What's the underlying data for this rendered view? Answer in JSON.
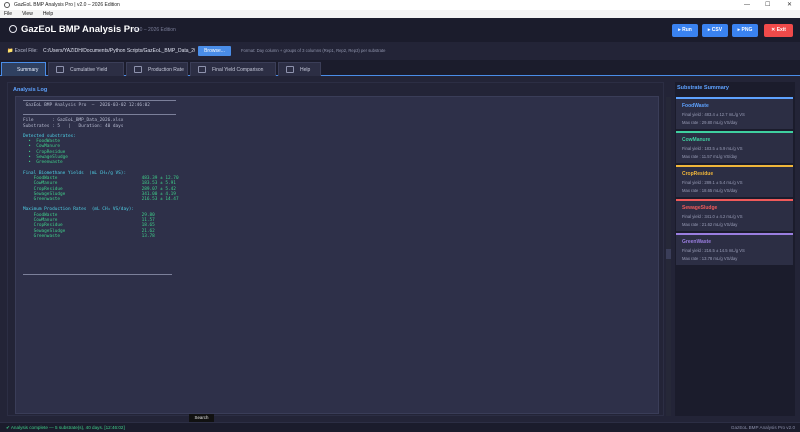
{
  "window": {
    "title": "GazEoL BMP Analysis Pro  |  v2.0 – 2026 Edition",
    "controls": {
      "minimize": "—",
      "maximize": "☐",
      "close": "✕"
    }
  },
  "menu": [
    "File",
    "View",
    "Help"
  ],
  "header": {
    "title": "GazEoL BMP Analysis Pro",
    "edition": "v2.0 – 2026 Edition",
    "buttons": {
      "run": "▸ Run",
      "csv": "▸ CSV",
      "png": "▸ PNG",
      "exit": "✕ Exit"
    },
    "colors": {
      "run": "#3a82f0",
      "csv": "#3a82f0",
      "png": "#3a82f0",
      "exit": "#f04a4a"
    }
  },
  "filebar": {
    "label": "📁 Excel File:",
    "path": "C:/Users/YAZIDH/Documents/Python Scripts/GazEoL_BMP_Data_20",
    "browse": "Browse...",
    "format_hint": "Format: Day column + groups of 3 columns (Rep1, Rep2, Rep3) per substrate"
  },
  "tabs": [
    {
      "label": "Summary",
      "icon": "summary-icon"
    },
    {
      "label": "Cumulative Yield",
      "icon": "chart-icon"
    },
    {
      "label": "Production Rate",
      "icon": "chart-icon"
    },
    {
      "label": "Final Yield Comparison",
      "icon": "chart-icon"
    },
    {
      "label": "Help",
      "icon": "help-icon"
    }
  ],
  "log": {
    "title": "Analysis Log",
    "header_line": "GazEoL BMP Analysis Pro  —  2026-03-02 12:46:02",
    "file_line": "File       : GazEoL_BMP_Data_2026.xlsx",
    "substrates_line": "Substrates : 5   |   Duration: 40 days",
    "detected_title": "Detected substrates:",
    "detected": [
      "FoodWaste",
      "CowManure",
      "CropResidue",
      "SewageSludge",
      "Greenwaste"
    ],
    "final_title": "Final Biomethane Yields  (mL CH₄/g VS):",
    "final": [
      {
        "name": "FoodWaste",
        "value": "483.39 ± 12.70"
      },
      {
        "name": "CowManure",
        "value": "183.53 ± 5.91"
      },
      {
        "name": "CropResidue",
        "value": "289.07 ± 5.42"
      },
      {
        "name": "SewageSludge",
        "value": "341.00 ± 4.19"
      },
      {
        "name": "Greenwaste",
        "value": "216.53 ± 14.47"
      }
    ],
    "rate_title": "Maximum Production Rates  (mL CH₄ VS/day):",
    "rates": [
      {
        "name": "FoodWaste",
        "value": "29.80"
      },
      {
        "name": "CowManure",
        "value": "11.57"
      },
      {
        "name": "CropResidue",
        "value": "18.65"
      },
      {
        "name": "SewageSludge",
        "value": "21.62"
      },
      {
        "name": "Greenwaste",
        "value": "13.78"
      }
    ]
  },
  "summary": {
    "title": "Substrate Summary",
    "cards": [
      {
        "name": "FoodWaste",
        "color": "#5ea2ff",
        "final": "Final yield : 483.4 ± 12.7 mL/g VS",
        "rate": "Max rate    : 29.80 mL/g VS/day"
      },
      {
        "name": "CowManure",
        "color": "#3fd0a0",
        "final": "Final yield : 183.5 ± 5.9 mL/g VS",
        "rate": "Max rate    : 11.57 mL/g VS/day"
      },
      {
        "name": "CropResidue",
        "color": "#f0b63a",
        "final": "Final yield : 289.1 ± 5.4 mL/g VS",
        "rate": "Max rate    : 18.65 mL/g VS/day"
      },
      {
        "name": "SewageSludge",
        "color": "#f05a5a",
        "final": "Final yield : 341.0 ± 4.2 mL/g VS",
        "rate": "Max rate    : 21.62 mL/g VS/day"
      },
      {
        "name": "GreenWaste",
        "color": "#9a7ee0",
        "final": "Final yield : 216.5 ± 14.5 mL/g VS",
        "rate": "Max rate    : 13.78 mL/g VS/day"
      }
    ]
  },
  "tooltip": "Search",
  "status": {
    "message": "✔ Analysis complete — 5 substrate(s), 40 days.  [12:46:02]",
    "version": "GazEoL BMP Analysis Pro v2.0"
  }
}
